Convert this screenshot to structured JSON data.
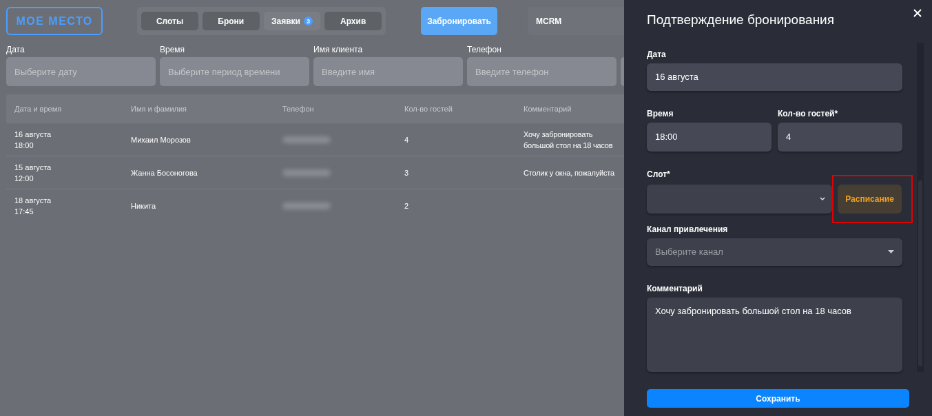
{
  "logo": "МОЕ МЕСТО",
  "nav_tabs": [
    {
      "label": "Слоты",
      "selected": false
    },
    {
      "label": "Брони",
      "selected": false
    },
    {
      "label": "Заявки",
      "selected": true,
      "badge": "3"
    },
    {
      "label": "Архив",
      "selected": false
    }
  ],
  "book_button": "Забронировать",
  "crm_button": "MCRM",
  "filters": [
    {
      "label": "Дата",
      "placeholder": "Выберите дату"
    },
    {
      "label": "Время",
      "placeholder": "Выберите период времени"
    },
    {
      "label": "Имя клиента",
      "placeholder": "Введите имя"
    },
    {
      "label": "Телефон",
      "placeholder": "Введите телефон"
    }
  ],
  "table": {
    "columns": [
      "Дата и время",
      "Имя и фамилия",
      "Телефон",
      "Кол-во гостей",
      "Комментарий"
    ],
    "rows": [
      {
        "date": "16 августа",
        "time": "18:00",
        "name": "Михаил Морозов",
        "phone_blurred": true,
        "guests": "4",
        "comment": "Хочу забронировать большой стол на 18 часов"
      },
      {
        "date": "15 августа",
        "time": "12:00",
        "name": "Жанна Босоногова",
        "phone_blurred": true,
        "guests": "3",
        "comment": "Столик у окна, пожалуйста"
      },
      {
        "date": "18 августа",
        "time": "17:45",
        "name": "Никита",
        "phone_blurred": true,
        "guests": "2"
      }
    ]
  },
  "panel": {
    "title": "Подтверждение бронирования",
    "date": {
      "label": "Дата",
      "value": "16 августа"
    },
    "time": {
      "label": "Время",
      "value": "18:00"
    },
    "guests": {
      "label": "Кол-во гостей*",
      "value": "4"
    },
    "slot": {
      "label": "Слот*",
      "schedule_button": "Расписание",
      "highlighted": true
    },
    "channel": {
      "label": "Канал привлечения",
      "placeholder": "Выберите канал"
    },
    "comment": {
      "label": "Комментарий",
      "value": "Хочу забронировать большой стол на 18 часов"
    },
    "save_button": "Сохранить"
  }
}
